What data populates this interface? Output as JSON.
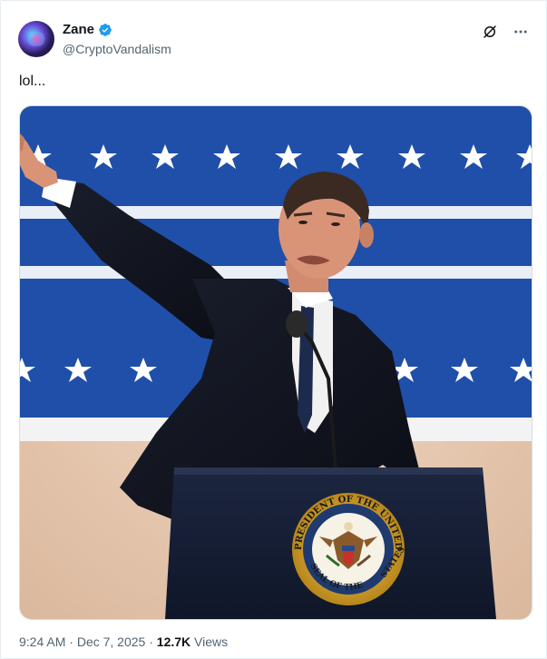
{
  "author": {
    "display_name": "Zane",
    "handle": "@CryptoVandalism",
    "verified": true,
    "avatar_icon": "cosmic-avatar"
  },
  "tweet": {
    "text": "lol..."
  },
  "media": {
    "seal_text_top": "PRESIDENT OF THE UNITED",
    "seal_text_bottom": "SEAL OF THE",
    "seal_text_right": "STATES"
  },
  "meta": {
    "time": "9:24 AM",
    "separator": "·",
    "date": "Dec 7, 2025",
    "views_count": "12.7K",
    "views_label": "Views"
  },
  "colors": {
    "verified_blue": "#1d9bf0",
    "banner_blue": "#1f4fa8",
    "secondary_text": "#536471"
  },
  "icons": [
    "verified-badge-icon",
    "grok-icon",
    "more-icon"
  ]
}
